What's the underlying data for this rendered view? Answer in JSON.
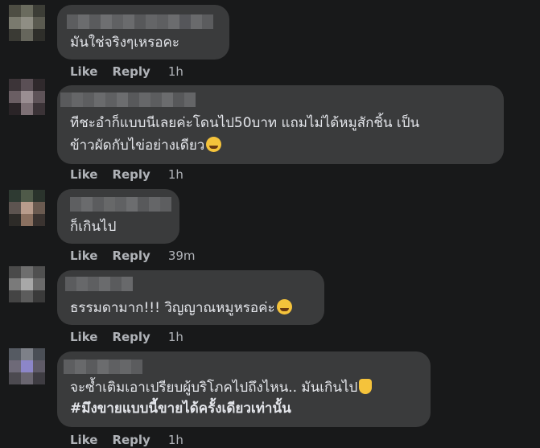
{
  "actions": {
    "like_label": "Like",
    "reply_label": "Reply"
  },
  "comments": [
    {
      "text_lines": [
        "มันใช่จริงๆเหรอคะ"
      ],
      "time": "1h"
    },
    {
      "text_lines": [
        "ทีชะอำก็แบบนีเลยค่ะโดนไป50บาท แถมไม่ได้หมูสักชิ้น เป็น",
        "ข้าวผัดกับไข่อย่างเดียว"
      ],
      "emoji": "sweat-smile-emoji",
      "time": "1h"
    },
    {
      "text_lines": [
        "ก็เกินไป"
      ],
      "time": "39m"
    },
    {
      "text_lines": [
        "ธรรมดามาก!!! วิญญาณหมูหรอค่ะ"
      ],
      "emoji": "tears-of-joy-emoji",
      "time": "1h"
    },
    {
      "text_lines": [
        "จะซ้ำเติมเอาเปรียบผู้บริโภคไปถึงไหน.. มันเกินไป",
        "#มึงขายแบบนี้ขายได้ครั้งเดียวเท่านั้น"
      ],
      "emoji": "thumbs-down-emoji",
      "time": "1h"
    }
  ],
  "colors": {
    "background": "#18191a",
    "bubble": "#3a3b3c",
    "text": "#e4e6eb",
    "muted": "#b0b3b8"
  }
}
